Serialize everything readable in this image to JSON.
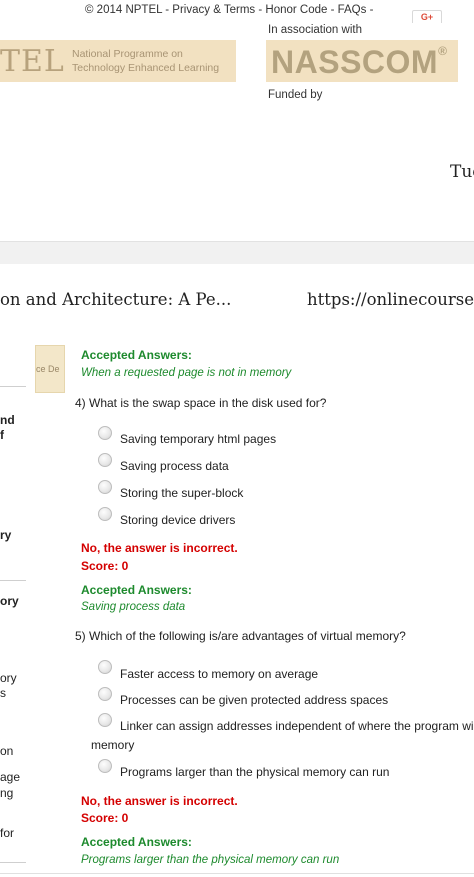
{
  "header": {
    "footer_line": "© 2014 NPTEL - Privacy & Terms - Honor Code - FAQs -",
    "gplus": "G+",
    "association": "In association with",
    "nptel_mark": "TEL",
    "nptel_line1": "National Programme on",
    "nptel_line2": "Technology Enhanced Learning",
    "nasscom": "NASSCOM",
    "funded_by": "Funded by",
    "date_stub": "Tue"
  },
  "tab": {
    "title": "on and Architecture: A Pe...",
    "url": "https://onlinecourses"
  },
  "sidebar": {
    "tab_label": "ce De",
    "fragments": [
      "nd",
      "f",
      "ry",
      "ory",
      "ory",
      "s",
      "on",
      "age",
      "ng",
      "for"
    ]
  },
  "quiz": {
    "prev": {
      "accepted_label": "Accepted Answers:",
      "accepted_value": "When a requested page is not in memory"
    },
    "q4": {
      "question": "4) What is the swap space in the disk used for?",
      "options": [
        "Saving temporary html pages",
        "Saving process data",
        "Storing the super-block",
        "Storing device drivers"
      ],
      "result": "No, the answer is incorrect.",
      "score": "Score: 0",
      "accepted_label": "Accepted Answers:",
      "accepted_value": "Saving process data"
    },
    "q5": {
      "question": "5) Which of the following is/are advantages of virtual memory?",
      "options": [
        "Faster access to memory on average",
        "Processes can be given protected address spaces",
        "Linker can assign addresses independent of where the program will",
        "Programs larger than the physical memory can run"
      ],
      "option3_wrap": "memory",
      "result": "No, the answer is incorrect.",
      "score": "Score: 0",
      "accepted_label": "Accepted Answers:",
      "accepted_value": "Programs larger than the physical memory can run"
    }
  }
}
